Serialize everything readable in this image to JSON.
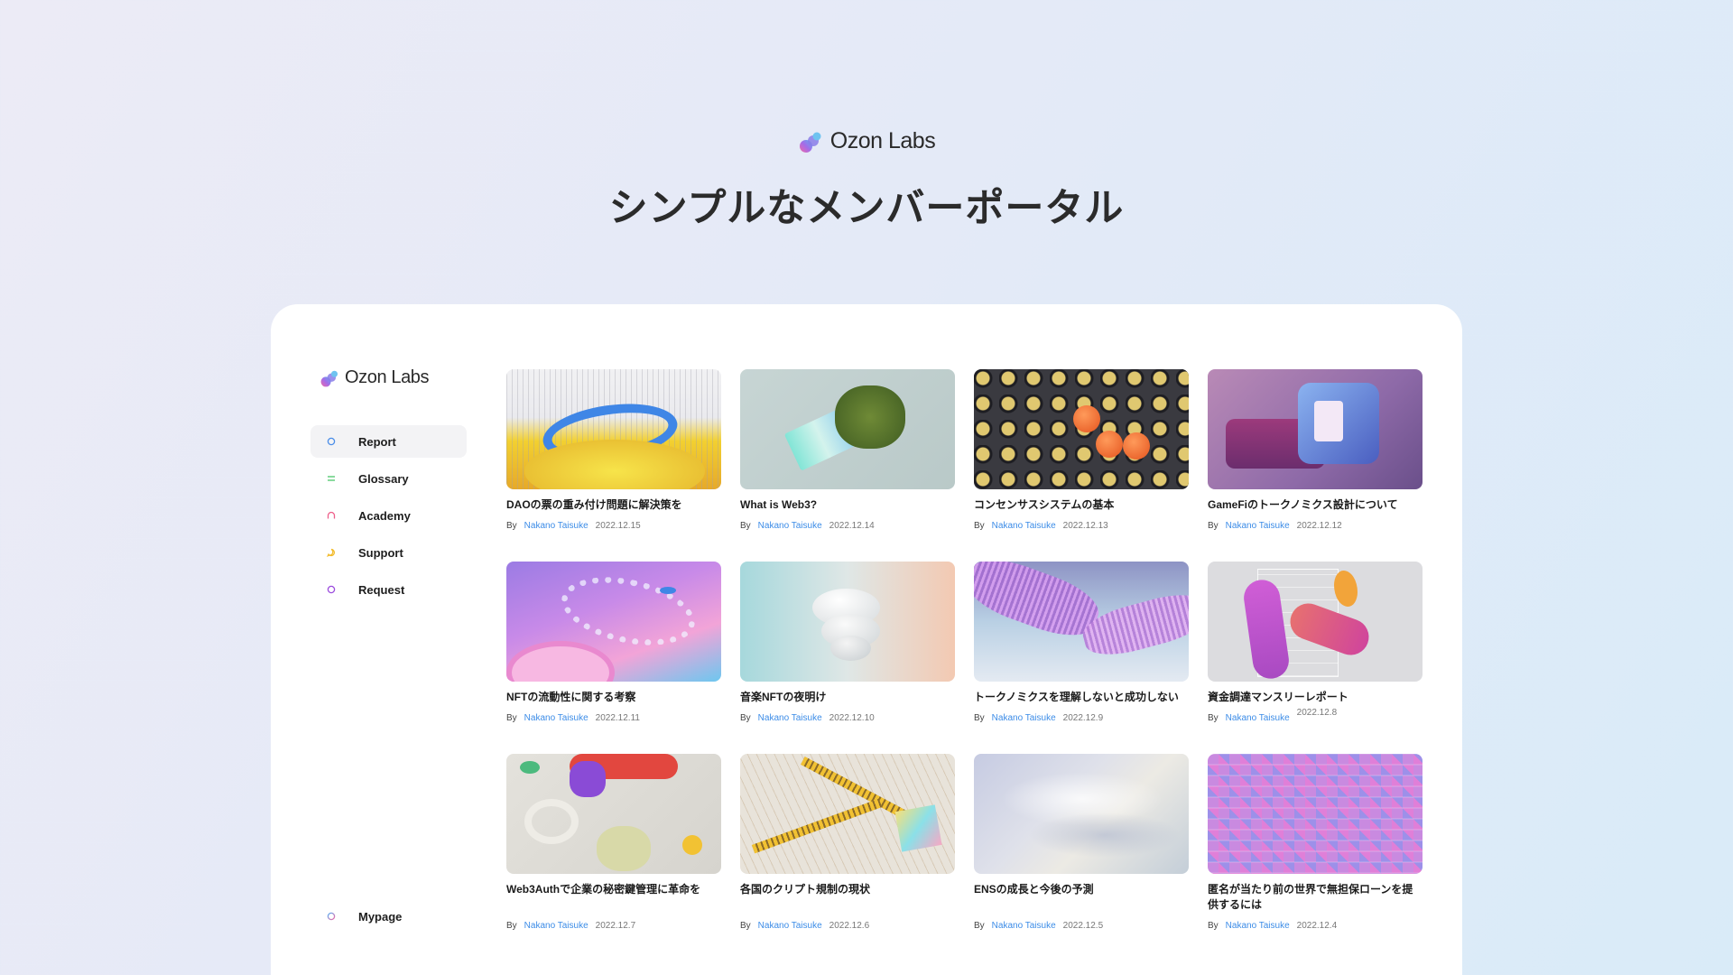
{
  "hero": {
    "brand": "Ozon Labs",
    "title": "シンプルなメンバーポータル"
  },
  "sidebar": {
    "brand": "Ozon Labs",
    "items": [
      {
        "label": "Report",
        "icon": "circle-icon",
        "color": "#4a8de8",
        "active": true
      },
      {
        "label": "Glossary",
        "icon": "list-icon",
        "color": "#4cc56a",
        "active": false
      },
      {
        "label": "Academy",
        "icon": "arch-icon",
        "color": "#ee5f8a",
        "active": false
      },
      {
        "label": "Support",
        "icon": "chat-icon",
        "color": "#f2bb2b",
        "active": false
      },
      {
        "label": "Request",
        "icon": "ring-icon",
        "color": "#9b4bdd",
        "active": false
      }
    ],
    "bottom": {
      "label": "Mypage",
      "icon": "gradient-ring-icon"
    }
  },
  "articles": [
    {
      "title": "DAOの票の重み付け問題に解決策を",
      "by": "By",
      "author": "Nakano Taisuke",
      "date": "2022.12.15"
    },
    {
      "title": "What is Web3?",
      "by": "By",
      "author": "Nakano Taisuke",
      "date": "2022.12.14"
    },
    {
      "title": "コンセンサスシステムの基本",
      "by": "By",
      "author": "Nakano Taisuke",
      "date": "2022.12.13"
    },
    {
      "title": "GameFiのトークノミクス設計について",
      "by": "By",
      "author": "Nakano Taisuke",
      "date": "2022.12.12"
    },
    {
      "title": "NFTの流動性に関する考察",
      "by": "By",
      "author": "Nakano Taisuke",
      "date": "2022.12.11"
    },
    {
      "title": "音楽NFTの夜明け",
      "by": "By",
      "author": "Nakano Taisuke",
      "date": "2022.12.10"
    },
    {
      "title": "トークノミクスを理解しないと成功しない",
      "by": "By",
      "author": "Nakano Taisuke",
      "date": "2022.12.9"
    },
    {
      "title": "資金調達マンスリーレポート",
      "by": "By",
      "author": "Nakano Taisuke",
      "date": "2022.12.8"
    },
    {
      "title": "Web3Authで企業の秘密鍵管理に革命を",
      "by": "By",
      "author": "Nakano Taisuke",
      "date": "2022.12.7"
    },
    {
      "title": "各国のクリプト規制の現状",
      "by": "By",
      "author": "Nakano Taisuke",
      "date": "2022.12.6"
    },
    {
      "title": "ENSの成長と今後の予測",
      "by": "By",
      "author": "Nakano Taisuke",
      "date": "2022.12.5"
    },
    {
      "title": "匿名が当たり前の世界で無担保ローンを提供するには",
      "by": "By",
      "author": "Nakano Taisuke",
      "date": "2022.12.4"
    }
  ]
}
